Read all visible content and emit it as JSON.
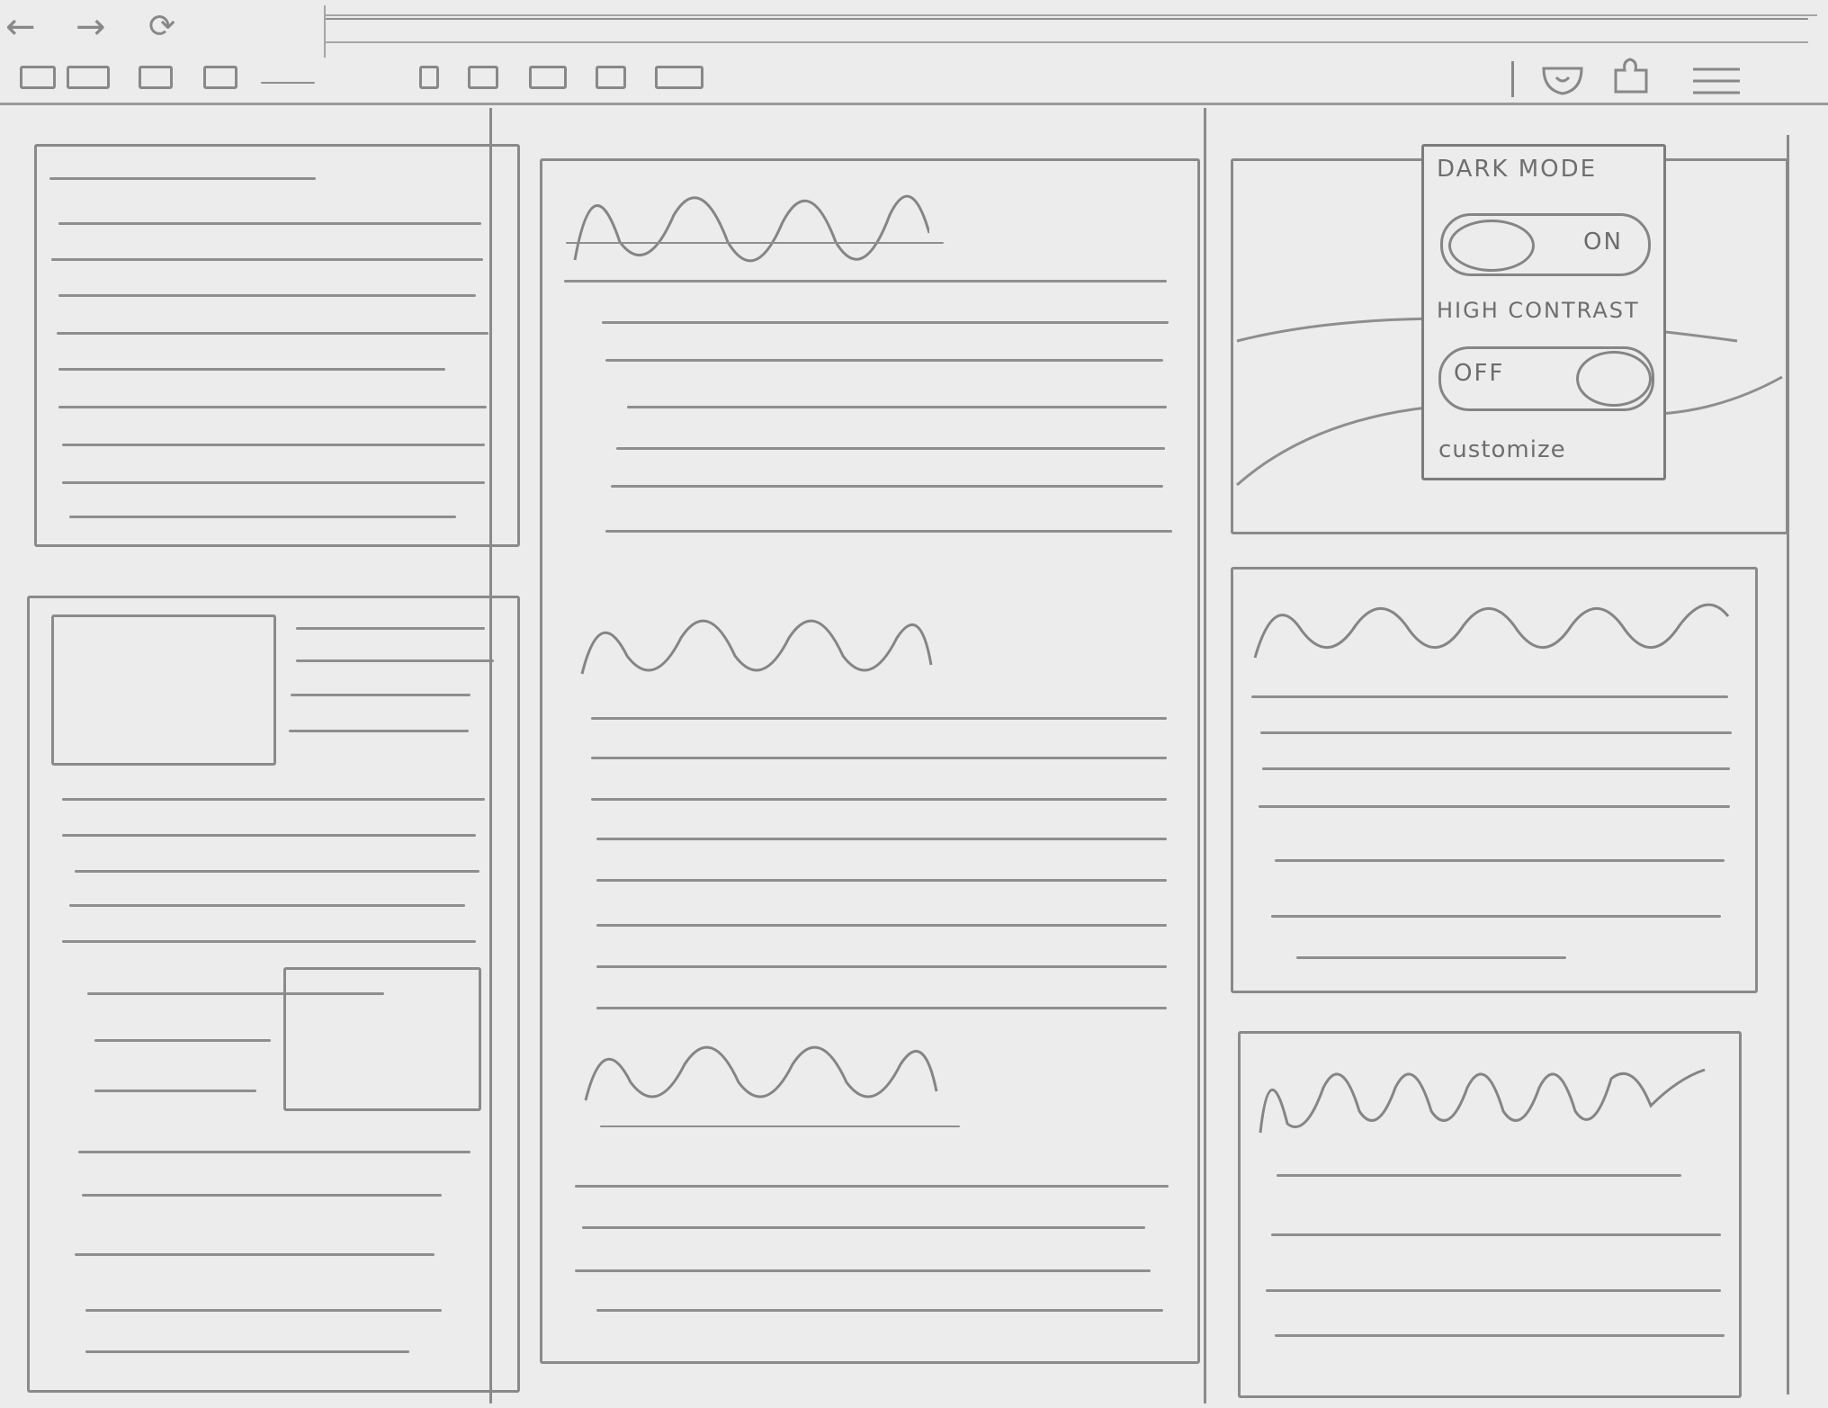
{
  "settings_menu": {
    "dark_mode_label": "DARK MODE",
    "dark_mode_state": "ON",
    "high_contrast_label": "HIGH CONTRAST",
    "high_contrast_state": "OFF",
    "customize_label": "customize"
  },
  "icons": {
    "back": "back-arrow-icon",
    "forward": "forward-arrow-icon",
    "reload": "reload-icon",
    "shield": "shield-icon",
    "extensions": "puzzle-icon",
    "menu": "hamburger-menu-icon"
  },
  "colors": {
    "paper": "#ececec",
    "pencil": "#8a8a8a"
  }
}
